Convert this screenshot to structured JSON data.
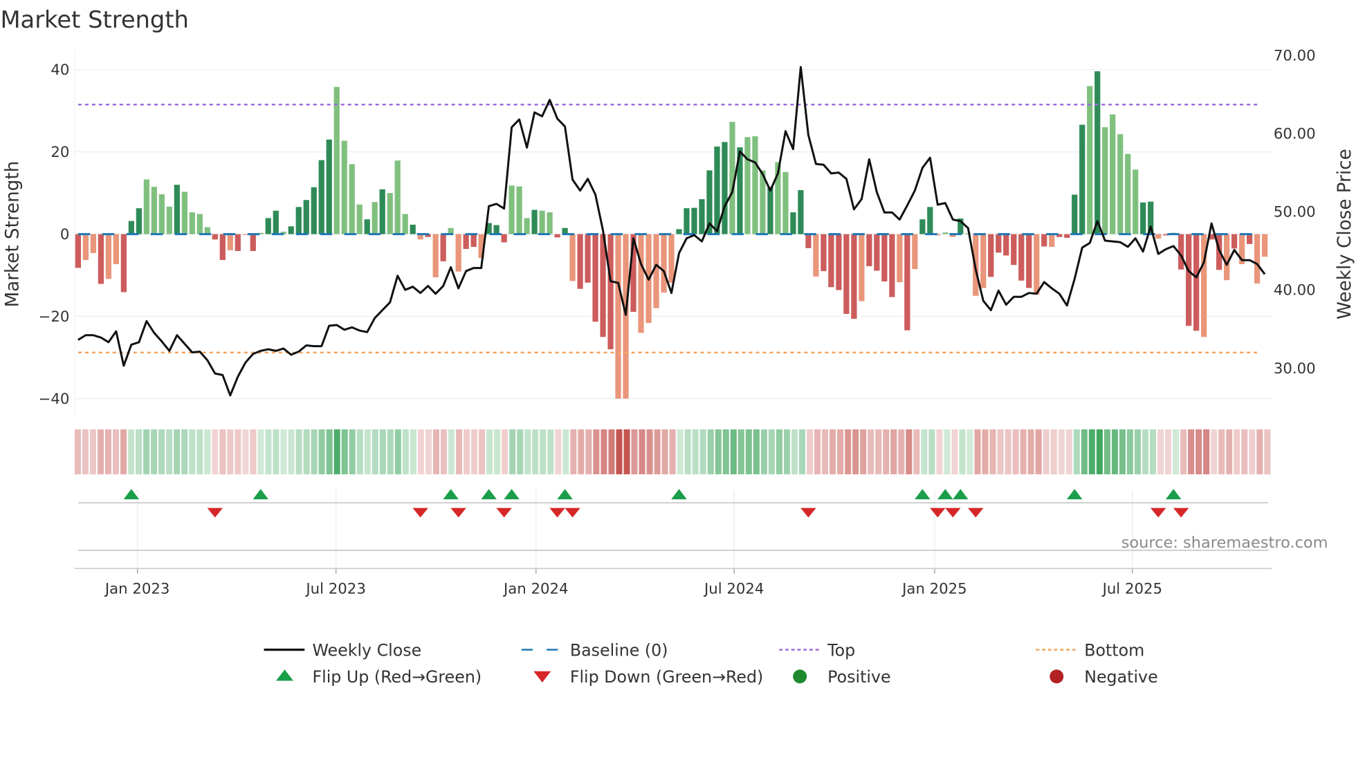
{
  "title": "Market Strength",
  "source": "source: sharemaestro.com",
  "chart_data": {
    "type": "bar",
    "title": "Market Strength",
    "ylabel": "Market Strength",
    "y2label": "Weekly Close Price",
    "ylim": [
      -44,
      44
    ],
    "y2lim": [
      23.9,
      70.8
    ],
    "y_ticks": [
      {
        "v": 40,
        "label": "40"
      },
      {
        "v": 20,
        "label": "20"
      },
      {
        "v": 0,
        "label": "0"
      },
      {
        "v": -20,
        "label": "−20"
      },
      {
        "v": -40,
        "label": "−40"
      }
    ],
    "y2_ticks": [
      {
        "v": 70,
        "label": "70.00"
      },
      {
        "v": 60,
        "label": "60.00"
      },
      {
        "v": 50,
        "label": "50.00"
      },
      {
        "v": 40,
        "label": "40.00"
      },
      {
        "v": 30,
        "label": "30.00"
      }
    ],
    "x_ticks": [
      {
        "week": 7.8,
        "label": "Jan 2023"
      },
      {
        "week": 33.9,
        "label": "Jul 2023"
      },
      {
        "week": 60.2,
        "label": "Jan 2024"
      },
      {
        "week": 86.25,
        "label": "Jul 2024"
      },
      {
        "week": 112.6,
        "label": "Jan 2025"
      },
      {
        "week": 138.6,
        "label": "Jul 2025"
      }
    ],
    "top_level": 31.5,
    "bottom_level": -28.8,
    "baseline": 0,
    "strength": [
      -8.2,
      -6.3,
      -4.6,
      -12.1,
      -10.9,
      -7.3,
      -14.1,
      3.2,
      6.3,
      13.3,
      11.5,
      9.7,
      6.7,
      12.0,
      10.3,
      5.3,
      4.9,
      1.7,
      -1.3,
      -6.3,
      -3.9,
      -4.1,
      -0.2,
      -4.1,
      0.3,
      3.9,
      5.7,
      0.6,
      1.9,
      6.6,
      8.3,
      11.4,
      18.0,
      23.0,
      35.8,
      22.7,
      17.0,
      7.2,
      3.6,
      7.8,
      10.9,
      10.0,
      17.9,
      4.9,
      2.3,
      -1.3,
      -0.7,
      -10.5,
      -6.6,
      1.5,
      -9.1,
      -3.6,
      -3.1,
      -5.8,
      2.7,
      2.2,
      -2.0,
      11.8,
      11.6,
      3.9,
      5.9,
      5.7,
      5.3,
      -0.8,
      1.5,
      -11.4,
      -13.3,
      -11.8,
      -21.3,
      -25,
      -28,
      -40,
      -40,
      -18.9,
      -24,
      -21.6,
      -18.0,
      -14.2,
      -11.8,
      1.2,
      6.3,
      6.4,
      8.5,
      15.5,
      21.3,
      22.4,
      27.3,
      21.1,
      23.6,
      23.8,
      15.5,
      11.5,
      17.5,
      15.1,
      5.3,
      10.7,
      -3.4,
      -10.3,
      -9.0,
      -12.9,
      -13.6,
      -19.4,
      -20.6,
      -16.3,
      -7.8,
      -8.9,
      -11.5,
      -15.3,
      -11.7,
      -23.4,
      -8.5,
      3.6,
      6.6,
      -0.3,
      0.4,
      -0.7,
      3.8,
      0.2,
      -15.0,
      -13.1,
      -10.4,
      -4.5,
      -5.2,
      -7.5,
      -11.3,
      -13.1,
      -14.7,
      -3.0,
      -3.1,
      -0.7,
      -0.9,
      9.6,
      26.6,
      36.0,
      39.6,
      26.0,
      29.1,
      24.3,
      19.5,
      15.7,
      7.7,
      7.9,
      -1.1,
      -0.3,
      0.3,
      -8.6,
      -22.3,
      -23.5,
      -25,
      -1.3,
      -8.7,
      -11.2,
      -3.5,
      -7.3,
      -2.4,
      -12.0,
      -5.5
    ],
    "shade": "dlldlldddlllldllllddldldlddlddddddlllldldllldldldllddldddllldllddldddddlldllllldddddddldllldlldddldddddlddddldlddllldlllddddddldlddddldlllllddldddddlddldldl",
    "weekly_close": [
      33.6,
      34.2,
      34.2,
      33.9,
      33.3,
      34.7,
      30.3,
      33.0,
      33.3,
      36.0,
      34.5,
      33.4,
      32.2,
      34.2,
      33.1,
      32.0,
      32.1,
      31.0,
      29.3,
      29.1,
      26.5,
      28.9,
      30.7,
      31.8,
      32.2,
      32.4,
      32.2,
      32.5,
      31.7,
      32.1,
      32.9,
      32.8,
      32.8,
      35.4,
      35.5,
      34.9,
      35.2,
      34.8,
      34.6,
      36.4,
      37.4,
      38.4,
      41.8,
      40.0,
      40.4,
      39.6,
      40.5,
      39.5,
      40.5,
      42.9,
      40.2,
      42.4,
      42.8,
      42.8,
      50.7,
      51.0,
      50.4,
      60.8,
      61.8,
      58.2,
      62.7,
      62.2,
      64.3,
      61.9,
      60.9,
      54.1,
      52.7,
      54.2,
      52.2,
      47.6,
      41.1,
      40.9,
      36.8,
      46.6,
      43.3,
      41.3,
      43.2,
      42.4,
      39.6,
      44.7,
      46.6,
      47.0,
      46.2,
      48.5,
      47.5,
      50.7,
      52.5,
      57.7,
      56.7,
      56.3,
      54.8,
      52.7,
      54.9,
      60.3,
      58.0,
      68.5,
      59.8,
      56.1,
      56.0,
      54.9,
      55.0,
      54.2,
      50.3,
      51.6,
      56.7,
      52.5,
      49.9,
      49.9,
      49.0,
      50.8,
      52.7,
      55.6,
      56.9,
      50.9,
      51.1,
      49.0,
      48.8,
      47.9,
      42.6,
      38.6,
      37.4,
      39.9,
      38.1,
      39.1,
      39.1,
      39.6,
      39.5,
      41.0,
      40.2,
      39.5,
      38.0,
      41.4,
      45.4,
      46.0,
      48.8,
      46.3,
      46.2,
      46.1,
      45.5,
      46.6,
      44.9,
      48.1,
      44.6,
      45.2,
      45.6,
      44.4,
      42.4,
      41.6,
      43.5,
      48.5,
      45.1,
      43.2,
      45.1,
      43.8,
      43.8,
      43.3,
      42.0
    ],
    "flip_up_weeks": [
      7,
      24,
      49,
      54,
      57,
      64,
      79,
      111,
      114,
      116,
      131,
      144
    ],
    "flip_down_weeks": [
      18,
      45,
      50,
      56,
      63,
      65,
      96,
      113,
      115,
      118,
      142,
      145
    ],
    "legend_position": "bottom",
    "legend": [
      {
        "key": "weekly_close",
        "label": "Weekly Close"
      },
      {
        "key": "baseline",
        "label": "Baseline (0)"
      },
      {
        "key": "top",
        "label": "Top"
      },
      {
        "key": "bottom",
        "label": "Bottom"
      },
      {
        "key": "flip_up",
        "label": "Flip Up (Red→Green)"
      },
      {
        "key": "flip_down",
        "label": "Flip Down (Green→Red)"
      },
      {
        "key": "positive",
        "label": "Positive"
      },
      {
        "key": "negative",
        "label": "Negative"
      }
    ]
  },
  "colors": {
    "pos_strong": "#2e8b57",
    "pos_weak": "#80c07f",
    "neg_strong": "#cd5c5c",
    "neg_weak": "#e9967a",
    "line": "#111111",
    "baseline": "#1f77b4",
    "top": "#9b6ddc",
    "bottom": "#f4a460",
    "flip_up": "#1a9e4a",
    "flip_down": "#d62728",
    "positive": "#1f8a2e",
    "negative": "#b22222",
    "grid": "#eef0f2"
  }
}
